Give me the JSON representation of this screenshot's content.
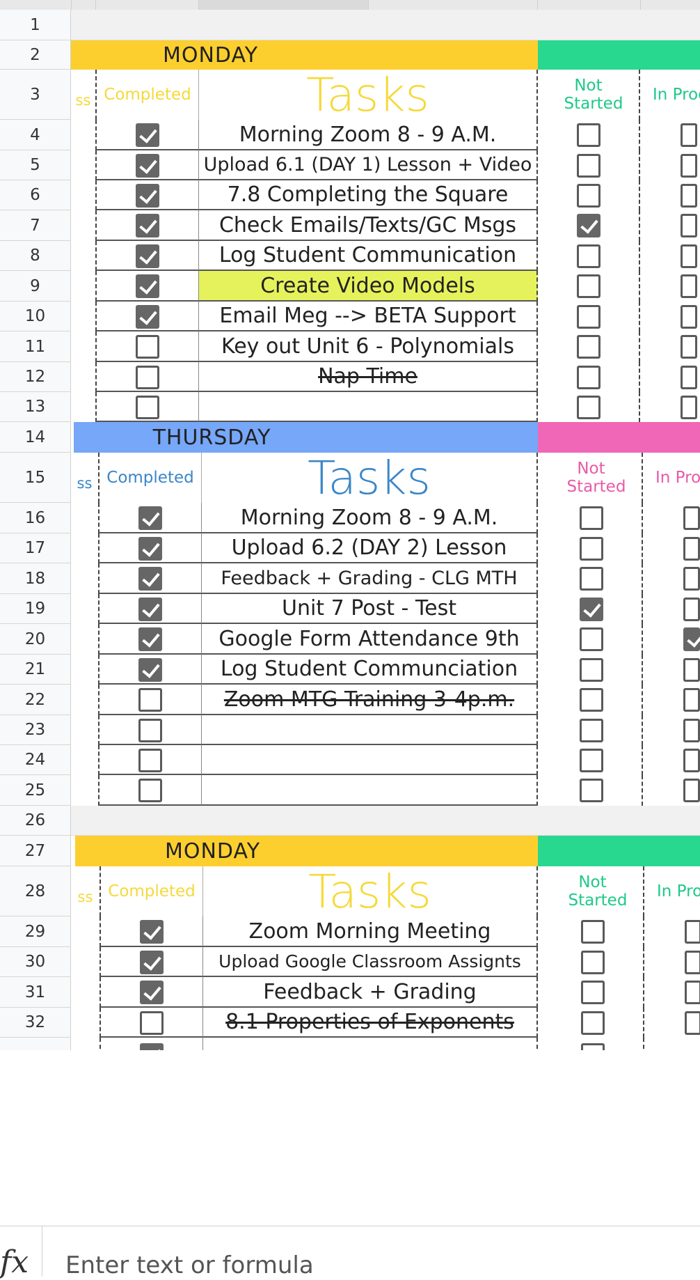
{
  "sections": [
    {
      "day": "MONDAY",
      "day_color": "#fdcf2e",
      "status_color": "#28d88f",
      "accent_color": "#f5d93a",
      "col_completed": "Completed",
      "col_tasks": "Tasks",
      "col_not_started": "Not Started",
      "col_in_progress": "In Progr",
      "col_partial": "ss",
      "rows": [
        {
          "num": "4",
          "completed": true,
          "task": "Morning Zoom 8 - 9 A.M.",
          "not_started": false,
          "in_progress": false
        },
        {
          "num": "5",
          "completed": true,
          "task": "Upload 6.1 (DAY 1) Lesson + Video",
          "not_started": false,
          "in_progress": false,
          "size": "small"
        },
        {
          "num": "6",
          "completed": true,
          "task": "7.8 Completing the Square",
          "not_started": false,
          "in_progress": false
        },
        {
          "num": "7",
          "completed": true,
          "task": "Check Emails/Texts/GC Msgs",
          "not_started": true,
          "in_progress": false
        },
        {
          "num": "8",
          "completed": true,
          "task": "Log Student Communication",
          "not_started": false,
          "in_progress": false
        },
        {
          "num": "9",
          "completed": true,
          "task": "Create Video Models",
          "not_started": false,
          "in_progress": false,
          "highlight": true
        },
        {
          "num": "10",
          "completed": true,
          "task": "Email Meg --> BETA Support",
          "not_started": false,
          "in_progress": false
        },
        {
          "num": "11",
          "completed": false,
          "task": "Key out Unit 6 - Polynomials",
          "not_started": false,
          "in_progress": false
        },
        {
          "num": "12",
          "completed": false,
          "task": "Nap Time",
          "not_started": false,
          "in_progress": false,
          "strike": true
        },
        {
          "num": "13",
          "completed": false,
          "task": "",
          "not_started": false,
          "in_progress": false
        }
      ]
    },
    {
      "day": "THURSDAY",
      "day_color": "#76a7f8",
      "status_color": "#f067b8",
      "accent_color": "#3a86c8",
      "accent2_color": "#e85aa8",
      "col_completed": "Completed",
      "col_tasks": "Tasks",
      "col_not_started": "Not Started",
      "col_in_progress": "In Progr",
      "col_partial": "ss",
      "rows": [
        {
          "num": "16",
          "completed": true,
          "task": "Morning Zoom 8 - 9 A.M.",
          "not_started": false,
          "in_progress": false
        },
        {
          "num": "17",
          "completed": true,
          "task": "Upload 6.2 (DAY 2) Lesson",
          "not_started": false,
          "in_progress": false
        },
        {
          "num": "18",
          "completed": true,
          "task": "Feedback + Grading - CLG MTH",
          "not_started": false,
          "in_progress": false,
          "size": "small"
        },
        {
          "num": "19",
          "completed": true,
          "task": "Unit 7 Post - Test",
          "not_started": true,
          "in_progress": false
        },
        {
          "num": "20",
          "completed": true,
          "task": "Google Form Attendance 9th",
          "not_started": false,
          "in_progress": true
        },
        {
          "num": "21",
          "completed": true,
          "task": "Log Student Communciation",
          "not_started": false,
          "in_progress": false
        },
        {
          "num": "22",
          "completed": false,
          "task": "Zoom MTG Training 3-4p.m.",
          "not_started": false,
          "in_progress": false,
          "strike": true
        },
        {
          "num": "23",
          "completed": false,
          "task": "",
          "not_started": false,
          "in_progress": false
        },
        {
          "num": "24",
          "completed": false,
          "task": "",
          "not_started": false,
          "in_progress": false
        },
        {
          "num": "25",
          "completed": false,
          "task": "",
          "not_started": false,
          "in_progress": false
        }
      ]
    },
    {
      "day": "MONDAY",
      "day_color": "#fdcf2e",
      "status_color": "#28d88f",
      "accent_color": "#f5d93a",
      "col_completed": "Completed",
      "col_tasks": "Tasks",
      "col_not_started": "Not Started",
      "col_in_progress": "In Progr",
      "col_partial": "ss",
      "rows": [
        {
          "num": "29",
          "completed": true,
          "task": "Zoom Morning Meeting",
          "not_started": false,
          "in_progress": false
        },
        {
          "num": "30",
          "completed": true,
          "task": "Upload Google Classroom Assignts",
          "not_started": false,
          "in_progress": false,
          "size": "xsmall"
        },
        {
          "num": "31",
          "completed": true,
          "task": "Feedback + Grading",
          "not_started": false,
          "in_progress": false
        },
        {
          "num": "32",
          "completed": false,
          "task": "8.1 Properties of Exponents",
          "not_started": false,
          "in_progress": false,
          "strike": true
        }
      ]
    }
  ],
  "row_numbers": {
    "r1": "1",
    "r2": "2",
    "r3": "3",
    "r14": "14",
    "r15": "15",
    "r26": "26",
    "r27": "27",
    "r28": "28"
  },
  "formula_bar": {
    "fx_label": "fx",
    "placeholder": "Enter text or formula"
  }
}
